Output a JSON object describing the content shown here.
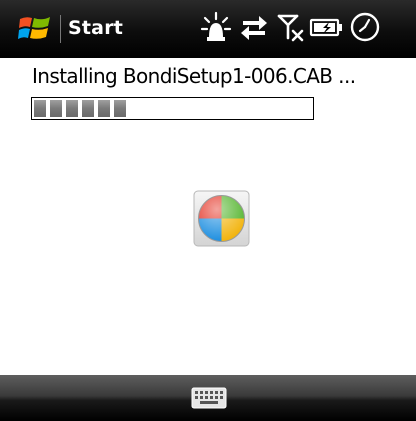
{
  "titlebar": {
    "start_label": "Start",
    "icons": [
      "windows-flag-icon",
      "notification-icon",
      "connectivity-icon",
      "signal-off-icon",
      "battery-charging-icon",
      "clock-icon"
    ]
  },
  "main": {
    "install_message": "Installing BondiSetup1-006.CAB ...",
    "progress": {
      "fraction": 0.35
    },
    "busy_icon": "busy-spinner-icon"
  },
  "softkeys": {
    "icon": "keyboard-icon"
  },
  "colors": {
    "titlebar": "#000000",
    "text": "#000000",
    "progress_fill": "#7a7a7a",
    "background": "#ffffff"
  }
}
